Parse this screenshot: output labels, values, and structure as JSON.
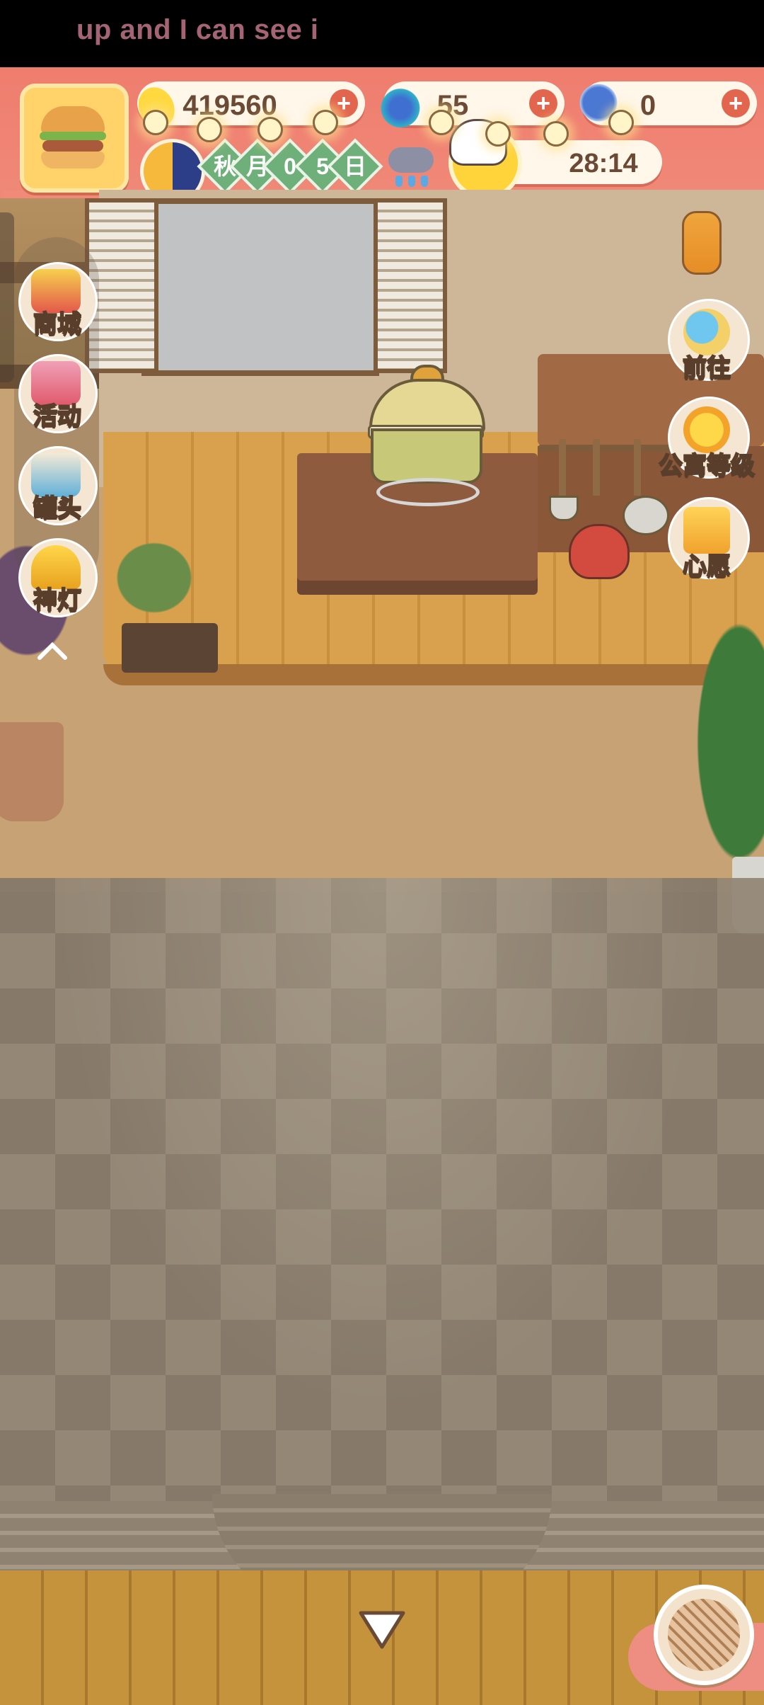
{
  "overlay": {
    "text": "up and I can see i"
  },
  "hud": {
    "avatar_icon": "burger-avatar-icon",
    "currencies": [
      {
        "icon": "banana-icon",
        "value": "419560"
      },
      {
        "icon": "flame-icon",
        "value": "55"
      },
      {
        "icon": "fish-icon",
        "value": "0"
      }
    ],
    "date": {
      "season": "秋",
      "month_char": "月",
      "day_digits": [
        "0",
        "5"
      ],
      "day_char": "日"
    },
    "weather_icon": "rain-cloud-icon",
    "timer": "28:14"
  },
  "left_menu": [
    {
      "label": "商城",
      "icon": "shop-icon"
    },
    {
      "label": "活动",
      "icon": "gift-icon"
    },
    {
      "label": "罐头",
      "icon": "can-icon"
    },
    {
      "label": "神灯",
      "icon": "magic-lamp-icon"
    }
  ],
  "right_menu": [
    {
      "label": "前往",
      "icon": "map-pin-icon"
    },
    {
      "label": "公寓等级",
      "icon": "sun-badge-icon"
    },
    {
      "label": "心愿",
      "icon": "heart-book-icon"
    }
  ]
}
